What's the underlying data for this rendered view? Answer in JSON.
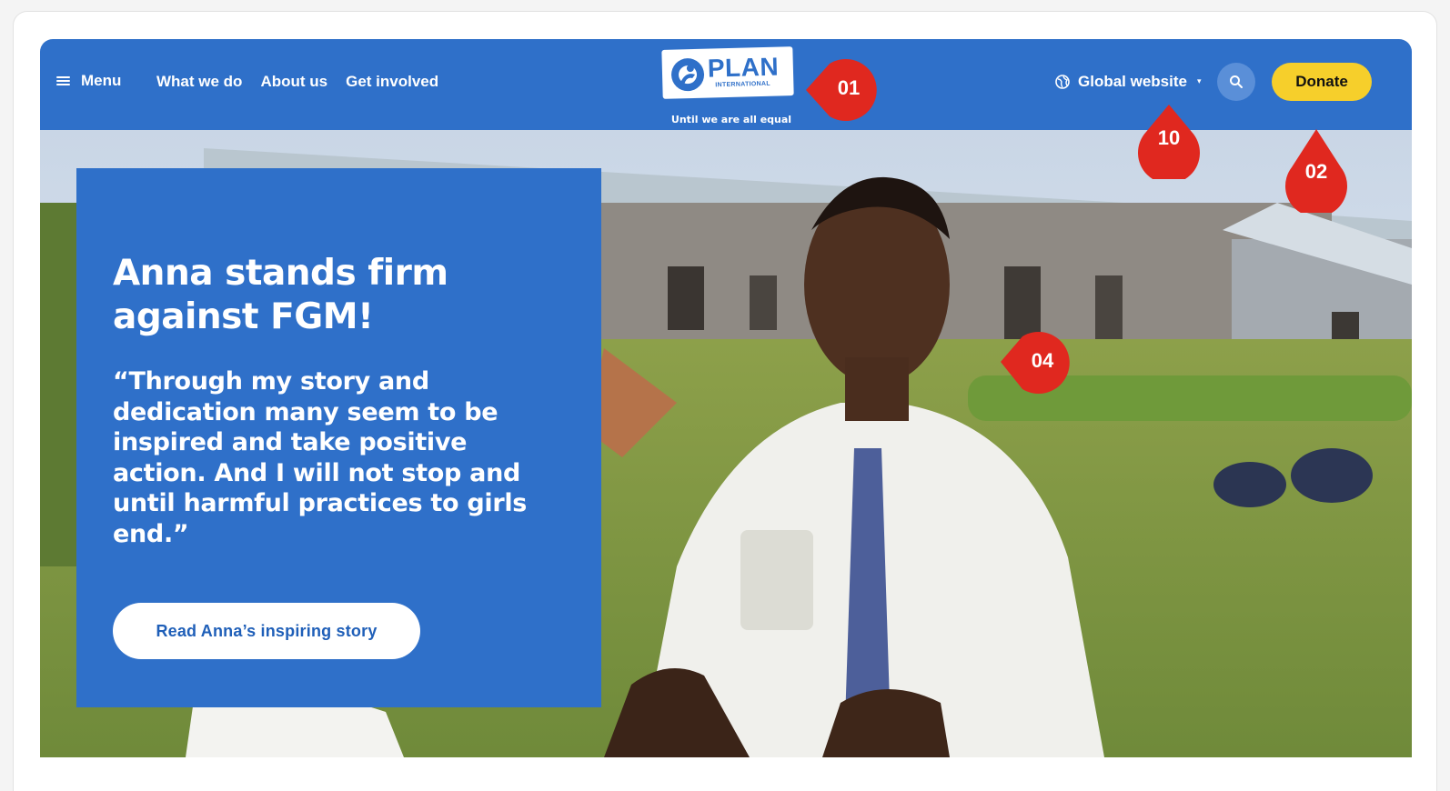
{
  "header": {
    "menu_label": "Menu",
    "nav": [
      "What we do",
      "About us",
      "Get involved"
    ],
    "logo": {
      "name": "PLAN",
      "sub": "INTERNATIONAL",
      "tagline": "Until we are all equal"
    },
    "global_label": "Global website",
    "donate_label": "Donate"
  },
  "hero": {
    "title": "Anna stands firm against FGM!",
    "quote": "“Through my story and dedication many seem to be inspired and take positive action. And I will not stop and until harmful practices to girls end.”",
    "cta_label": "Read Anna’s inspiring story"
  },
  "annotations": [
    "01",
    "10",
    "02",
    "04"
  ],
  "colors": {
    "brand_blue": "#2f70c9",
    "donate_yellow": "#f6cf2b",
    "marker_red": "#e0281f"
  },
  "icons": [
    "hamburger-icon",
    "globe-icon",
    "caret-down-icon",
    "search-icon"
  ]
}
